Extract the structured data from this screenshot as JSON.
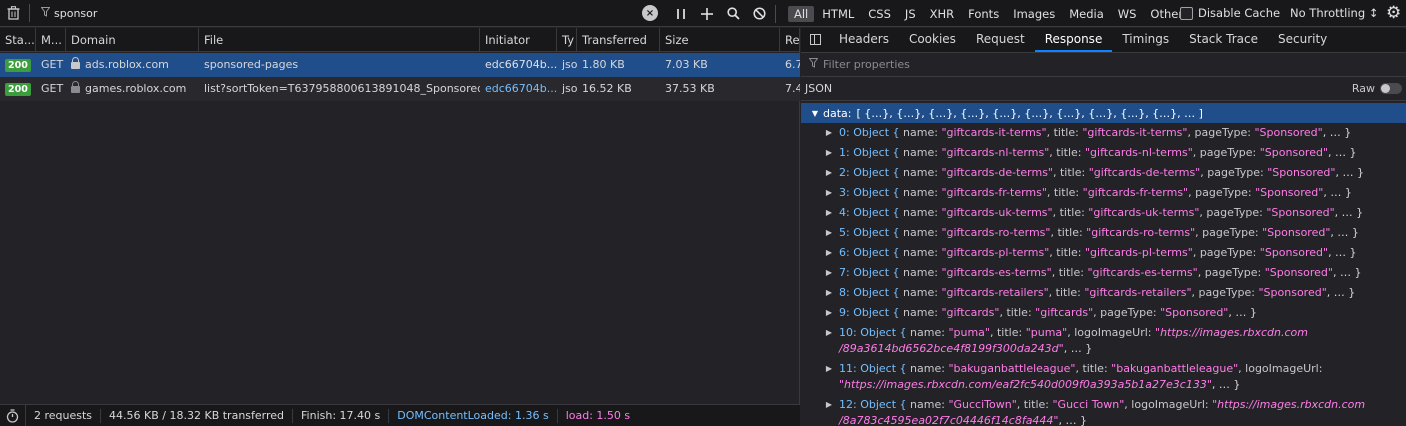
{
  "toolbar": {
    "filter_value": "sponsor",
    "types": [
      "All",
      "HTML",
      "CSS",
      "JS",
      "XHR",
      "Fonts",
      "Images",
      "Media",
      "WS",
      "Other"
    ],
    "active_type": "All",
    "disable_cache_label": "Disable Cache",
    "throttle_label": "No Throttling ↕"
  },
  "columns": [
    "Sta...",
    "M...",
    "Domain",
    "File",
    "Initiator",
    "Ty",
    "Transferred",
    "Size",
    "Re"
  ],
  "requests": [
    {
      "status": "200",
      "method": "GET",
      "domain": "ads.roblox.com",
      "file": "sponsored-pages",
      "initiator": "edc66704b...",
      "type": "jso",
      "transferred": "1.80 KB",
      "size": "7.03 KB",
      "re": "6.7"
    },
    {
      "status": "200",
      "method": "GET",
      "domain": "games.roblox.com",
      "file": "list?sortToken=T637958800613891048_Sponsored,N,H",
      "initiator": "edc66704b...",
      "type": "jso",
      "transferred": "16.52 KB",
      "size": "37.53 KB",
      "re": "7.4"
    }
  ],
  "statusbar": {
    "requests": "2 requests",
    "transferred": "44.56 KB / 18.32 KB transferred",
    "finish": "Finish: 17.40 s",
    "dom": "DOMContentLoaded: 1.36 s",
    "load": "load: 1.50 s"
  },
  "panel": {
    "tabs": [
      "Headers",
      "Cookies",
      "Request",
      "Response",
      "Timings",
      "Stack Trace",
      "Security"
    ],
    "active_tab": "Response",
    "filter_placeholder": "Filter properties",
    "json_label": "JSON",
    "raw_label": "Raw",
    "data_key": "data:",
    "data_preview": "[ {…}, {…}, {…}, {…}, {…}, {…}, {…}, {…}, {…}, {…}, … ]"
  },
  "entries": [
    {
      "idx": "0:",
      "name": "\"giftcards-it-terms\"",
      "title": "\"giftcards-it-terms\"",
      "pageType": "\"Sponsored\""
    },
    {
      "idx": "1:",
      "name": "\"giftcards-nl-terms\"",
      "title": "\"giftcards-nl-terms\"",
      "pageType": "\"Sponsored\""
    },
    {
      "idx": "2:",
      "name": "\"giftcards-de-terms\"",
      "title": "\"giftcards-de-terms\"",
      "pageType": "\"Sponsored\""
    },
    {
      "idx": "3:",
      "name": "\"giftcards-fr-terms\"",
      "title": "\"giftcards-fr-terms\"",
      "pageType": "\"Sponsored\""
    },
    {
      "idx": "4:",
      "name": "\"giftcards-uk-terms\"",
      "title": "\"giftcards-uk-terms\"",
      "pageType": "\"Sponsored\""
    },
    {
      "idx": "5:",
      "name": "\"giftcards-ro-terms\"",
      "title": "\"giftcards-ro-terms\"",
      "pageType": "\"Sponsored\""
    },
    {
      "idx": "6:",
      "name": "\"giftcards-pl-terms\"",
      "title": "\"giftcards-pl-terms\"",
      "pageType": "\"Sponsored\""
    },
    {
      "idx": "7:",
      "name": "\"giftcards-es-terms\"",
      "title": "\"giftcards-es-terms\"",
      "pageType": "\"Sponsored\""
    },
    {
      "idx": "8:",
      "name": "\"giftcards-retailers\"",
      "title": "\"giftcards-retailers\"",
      "pageType": "\"Sponsored\""
    },
    {
      "idx": "9:",
      "name": "\"giftcards\"",
      "title": "\"giftcards\"",
      "pageType": "\"Sponsored\""
    }
  ],
  "logo_entries": [
    {
      "idx": "10:",
      "name": "\"puma\"",
      "title": "\"puma\"",
      "url1": "\"https://images.rbxcdn.com",
      "url2": "/89a3614bd6562bce4f8199f300da243d\""
    },
    {
      "idx": "11:",
      "name": "\"bakuganbattleleague\"",
      "title": "\"bakuganbattleleague\"",
      "url1": "",
      "url2": "\"https://images.rbxcdn.com/eaf2fc540d009f0a393a5b1a27e3c133\""
    },
    {
      "idx": "12:",
      "name": "\"GucciTown\"",
      "title": "\"Gucci Town\"",
      "url1": "\"https://images.rbxcdn.com",
      "url2": "/8a783c4595ea02f7c04446f14c8fa444\""
    }
  ],
  "labels": {
    "object": "Object {",
    "name_key": "name:",
    "title_key": "title:",
    "pagetype_key": "pageType:",
    "logo_key": "logoImageUrl:",
    "tail": ", … }"
  }
}
